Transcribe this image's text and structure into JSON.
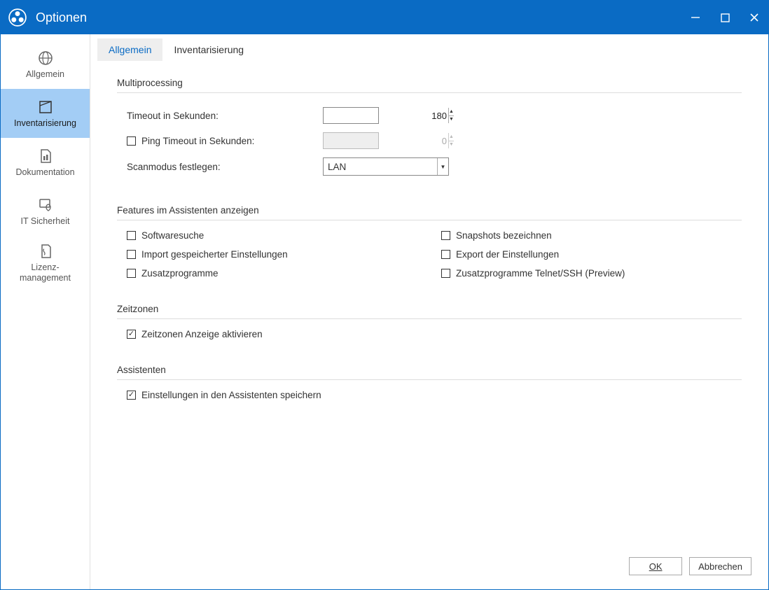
{
  "window": {
    "title": "Optionen"
  },
  "sidebar": {
    "items": [
      {
        "label": "Allgemein"
      },
      {
        "label": "Inventarisierung"
      },
      {
        "label": "Dokumentation"
      },
      {
        "label": "IT Sicherheit"
      },
      {
        "label": "Lizenz-\nmanagement"
      }
    ]
  },
  "tabs": {
    "allgemein": "Allgemein",
    "inventarisierung": "Inventarisierung"
  },
  "sections": {
    "multiprocessing": {
      "title": "Multiprocessing",
      "timeout_label": "Timeout in Sekunden:",
      "timeout_value": "180",
      "ping_label": "Ping Timeout in Sekunden:",
      "ping_value": "0",
      "scanmode_label": "Scanmodus festlegen:",
      "scanmode_value": "LAN"
    },
    "features": {
      "title": "Features im Assistenten anzeigen",
      "f1": "Softwaresuche",
      "f2": "Snapshots bezeichnen",
      "f3": "Import gespeicherter Einstellungen",
      "f4": "Export der Einstellungen",
      "f5": "Zusatzprogramme",
      "f6": "Zusatzprogramme Telnet/SSH (Preview)"
    },
    "zeitzonen": {
      "title": "Zeitzonen",
      "check": "Zeitzonen Anzeige aktivieren"
    },
    "assistenten": {
      "title": "Assistenten",
      "check": "Einstellungen in den Assistenten speichern"
    }
  },
  "footer": {
    "ok": "OK",
    "cancel": "Abbrechen"
  }
}
